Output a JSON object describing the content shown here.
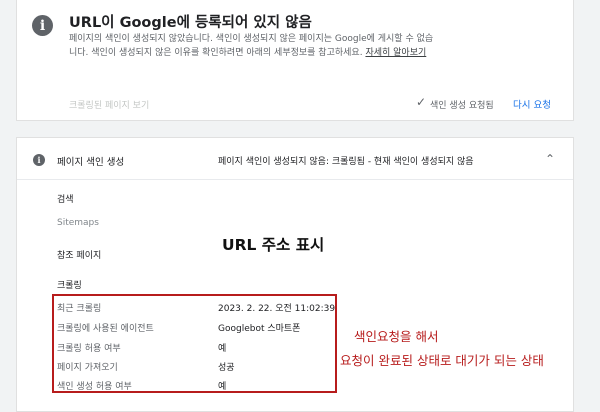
{
  "status_card": {
    "title": "URL이 Google에 등록되어 있지 않음",
    "description": "페이지의 색인이 생성되지 않았습니다. 색인이 생성되지 않은 페이지는 Google에 게시할 수 없습니다. 색인이 생성되지 않은 이유를 확인하려면 아래의 세부정보를 참고하세요.",
    "learn_more": "자세히 알아보기",
    "view_crawled": "크롤링된 페이지 보기",
    "index_requested": "색인 생성 요청됨",
    "retry": "다시 요청"
  },
  "index_card": {
    "title": "페이지 색인 생성",
    "status_value": "페이지 색인이 생성되지 않음: 크롤링됨 - 현재 색인이 생성되지 않음",
    "discovery_label": "검색",
    "sitemaps_label": "Sitemaps",
    "referring_label": "참조 페이지",
    "crawl_label": "크롤링",
    "rows": [
      {
        "label": "최근 크롤링",
        "value": "2023. 2. 22. 오전 11:02:39"
      },
      {
        "label": "크롤링에 사용된 에이전트",
        "value": "Googlebot 스마트폰"
      },
      {
        "label": "크롤링 허용 여부",
        "value": "예"
      },
      {
        "label": "페이지 가져오기",
        "value": "성공"
      },
      {
        "label": "색인 생성 허용 여부",
        "value": "예"
      }
    ]
  },
  "annotations": {
    "url_display": "URL 주소 표시",
    "note_line1": "색인요청을 해서",
    "note_line2": "요청이 완료된 상태로 대기가 되는 상태"
  },
  "colors": {
    "accent": "#1a73e8",
    "annotation_red": "#b71c1c"
  },
  "icons": {
    "status": "info-icon",
    "index": "info-icon",
    "check": "check-icon",
    "expand": "chevron-up-icon"
  }
}
